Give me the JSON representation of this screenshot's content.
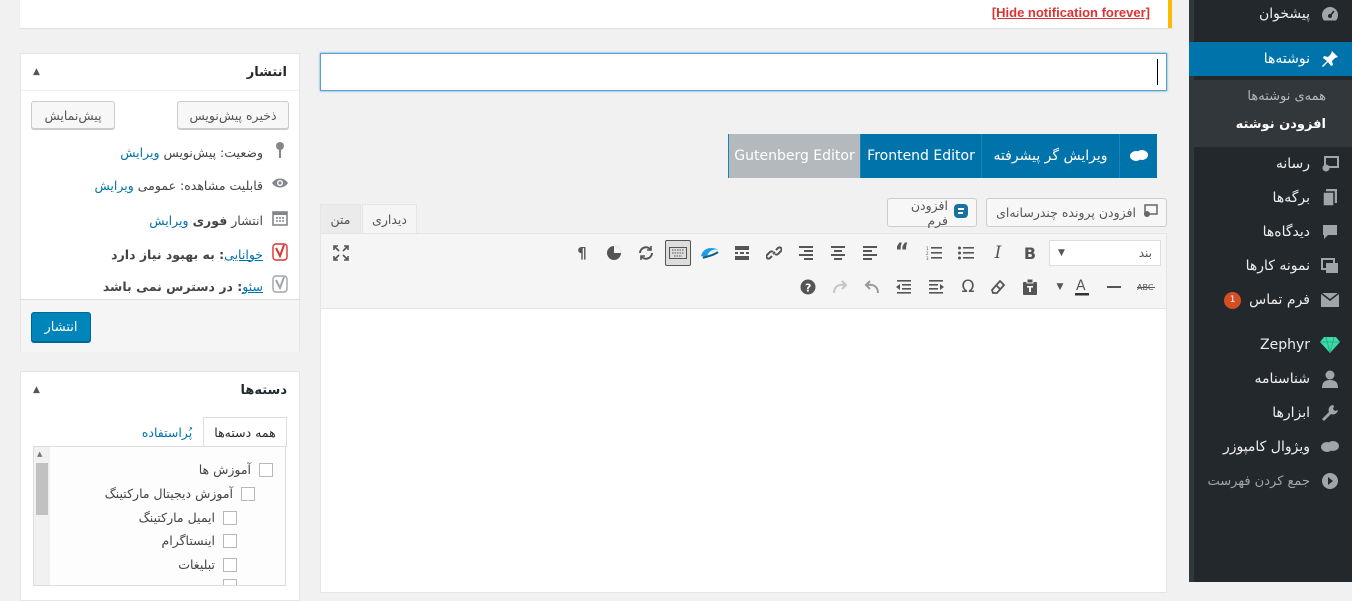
{
  "notice": {
    "link": "[Hide notification forever]"
  },
  "title_field": {
    "value": ""
  },
  "editor_switch": {
    "gutenberg": "Gutenberg Editor",
    "frontend": "Frontend Editor",
    "advanced": "ویرایش گر پیشرفته"
  },
  "media_buttons": {
    "add_media": "افزودن پرونده چندرسانه‌ای",
    "add_form": "افزودن فرم"
  },
  "editor_tabs": {
    "visual": "دیداری",
    "text": "متن"
  },
  "toolbar": {
    "format_select": "بند"
  },
  "sidebar": {
    "items": [
      {
        "label": "پیشخوان",
        "icon": "dashboard-icon"
      },
      {
        "label": "نوشته‌ها",
        "icon": "pin-icon"
      },
      {
        "label": "رسانه",
        "icon": "media-icon"
      },
      {
        "label": "برگه‌ها",
        "icon": "pages-icon"
      },
      {
        "label": "دیدگاه‌ها",
        "icon": "comments-icon"
      },
      {
        "label": "نمونه کارها",
        "icon": "portfolio-icon"
      },
      {
        "label": "فرم تماس",
        "icon": "mail-icon",
        "badge": "1"
      },
      {
        "label": "Zephyr",
        "icon": "diamond-icon"
      },
      {
        "label": "شناسنامه",
        "icon": "user-icon"
      },
      {
        "label": "ابزارها",
        "icon": "wrench-icon"
      },
      {
        "label": "ویژوال کامپوزر",
        "icon": "composer-icon"
      },
      {
        "label": "جمع کردن فهرست",
        "icon": "collapse-icon"
      }
    ],
    "submenu": {
      "all": "همه‌ی نوشته‌ها",
      "add": "افزودن نوشته"
    }
  },
  "publish_box": {
    "title": "انتشار",
    "save_draft": "ذخیره پیش‌نویس",
    "preview": "پیش‌نمایش",
    "status_label": "وضعیت: پیش‌نویس",
    "visibility_label": "قابلیت مشاهده: عمومی",
    "publish_label": "انتشار",
    "publish_value": "فوری",
    "edit": "ویرایش",
    "readability_link": "خوانایی",
    "readability_value": ": به بهبود نیاز دارد",
    "seo_link": "سئو",
    "seo_value": ": در دسترس نمی باشد",
    "publish_button": "انتشار"
  },
  "categories_box": {
    "title": "دسته‌ها",
    "tab_all": "همه دسته‌ها",
    "tab_popular": "پُراستفاده",
    "items": [
      "آموزش ها",
      "آموزش دیجیتال مارکتینگ",
      "ایمیل مارکتینگ",
      "اینستاگرام",
      "تبلیغات"
    ]
  },
  "colors": {
    "accent": "#0073aa",
    "sidebar_bg": "#23282d",
    "notice_border": "#ffb900",
    "notice_link": "#dc3232"
  }
}
